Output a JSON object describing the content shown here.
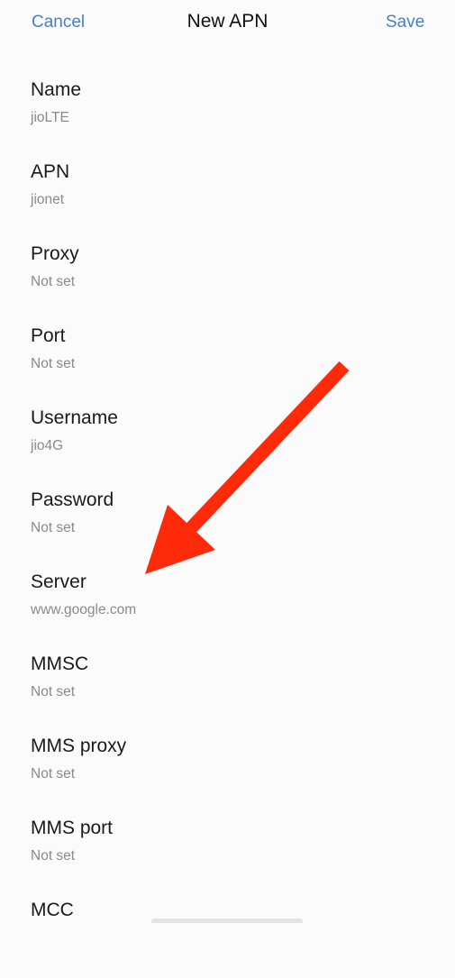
{
  "header": {
    "cancel_label": "Cancel",
    "title": "New APN",
    "save_label": "Save",
    "accent_color": "#4a7fc3"
  },
  "fields": [
    {
      "label": "Name",
      "value": "jioLTE"
    },
    {
      "label": "APN",
      "value": "jionet"
    },
    {
      "label": "Proxy",
      "value": "Not set"
    },
    {
      "label": "Port",
      "value": "Not set"
    },
    {
      "label": "Username",
      "value": "jio4G"
    },
    {
      "label": "Password",
      "value": "Not set"
    },
    {
      "label": "Server",
      "value": "www.google.com"
    },
    {
      "label": "MMSC",
      "value": "Not set"
    },
    {
      "label": "MMS proxy",
      "value": "Not set"
    },
    {
      "label": "MMS port",
      "value": "Not set"
    },
    {
      "label": "MCC",
      "value": ""
    }
  ],
  "annotation": {
    "type": "arrow",
    "points_to": "Server",
    "color": "#ff2a0a"
  }
}
